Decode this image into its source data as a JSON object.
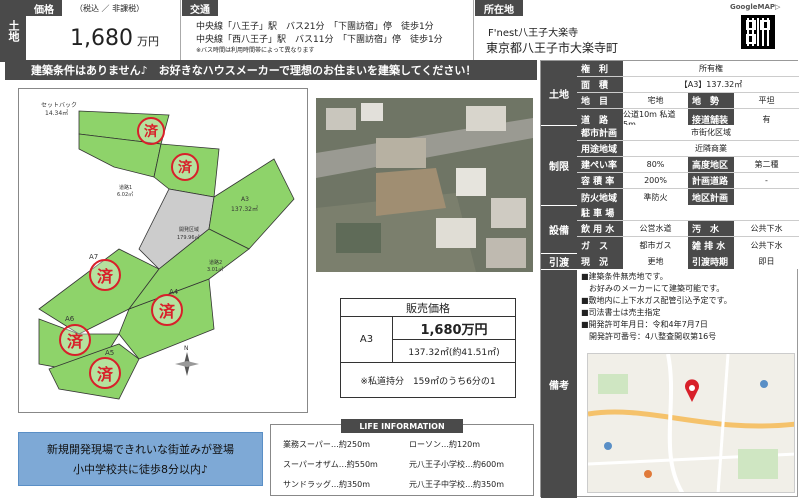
{
  "header": {
    "badge": "土地",
    "price_label": "価格",
    "tax_note": "（税込 ／ 非課税）",
    "price_value": "1,680",
    "price_unit": "万円",
    "access_label": "交通",
    "access_lines": [
      "中央線「八王子」駅　バス21分　「下團訪宿」停　徒歩1分",
      "中央線「西八王子」駅　バス11分　「下團訪宿」停　徒歩1分"
    ],
    "access_note": "※バス時間は利用時間帯によって異なります",
    "location_label": "所在地",
    "map_link": "GoogleMAP▷",
    "location_name": "F'nest八王子大楽寺",
    "location_address": "東京都八王子市大楽寺町"
  },
  "banner": "建築条件はありません♪　お好きなハウスメーカーで理想のお住まいを建築してください！",
  "plot": {
    "labels": [
      "セットバック\n14.34㎡",
      "A3\n137.32㎡",
      "開発区域\n179.96㎡",
      "道路1\n6.02㎡",
      "道路2\n3.01㎡",
      "A7",
      "A4",
      "A6",
      "A5"
    ],
    "sold_mark": "済"
  },
  "price_box": {
    "title": "販売価格",
    "lot": "A3",
    "price": "1,680万円",
    "area": "137.32㎡(約41.51㎡)",
    "share_note": "※私道持分　159㎡のうち6分の1"
  },
  "life": {
    "title": "LIFE INFORMATION",
    "items": [
      "業務スーパー…約250m",
      "ローソン…約120m",
      "スーパーオザム…約550m",
      "元八王子小学校…約600m",
      "サンドラッグ…約350m",
      "元八王子中学校…約350m"
    ]
  },
  "promo": {
    "line1": "新規開発現場できれいな街並みが登場",
    "line2": "小中学校共に徒歩8分以内♪"
  },
  "spec": {
    "land_section": "土地",
    "land": [
      {
        "label": "権　利",
        "value": "所有権"
      },
      {
        "label": "面　積",
        "value": "【A3】137.32㎡"
      },
      {
        "label": "地　目",
        "value": "宅地",
        "label2": "地　勢",
        "value2": "平坦"
      },
      {
        "label": "道　路",
        "value": "公道10m 私道5m",
        "label2": "接道舗装",
        "value2": "有"
      }
    ],
    "restrict_section": "制限",
    "restrict": [
      {
        "label": "都市計画",
        "value": "市街化区域"
      },
      {
        "label": "用途地域",
        "value": "近隣商業"
      },
      {
        "label": "建ぺい率",
        "value": "80%",
        "label2": "高度地区",
        "value2": "第二種"
      },
      {
        "label": "容 積 率",
        "value": "200%",
        "label2": "計画道路",
        "value2": "-"
      },
      {
        "label": "防火地域",
        "value": "準防火",
        "label2": "地区計画",
        "value2": ""
      }
    ],
    "facility_section": "設備",
    "facility": [
      {
        "label": "駐 車 場",
        "value": ""
      },
      {
        "label": "飲 用 水",
        "value": "公営水道",
        "label2": "汚　水",
        "value2": "公共下水"
      },
      {
        "label": "ガ　ス",
        "value": "都市ガス",
        "label2": "雑 排 水",
        "value2": "公共下水"
      }
    ],
    "handover_section": "引渡",
    "handover": [
      {
        "label": "現　況",
        "value": "更地",
        "label2": "引渡時期",
        "value2": "即日"
      }
    ],
    "remarks_section": "備考",
    "remarks": [
      "■建築条件無売地です。",
      "　お好みのメーカーにて建築可能です。",
      "■敷地内に上下水ガス配管引込予定です。",
      "■司法書士は売主指定",
      "■開発許可年月日：令和4年7月7日",
      "　開発許可番号：4八整査開収第16号"
    ]
  },
  "colors": {
    "accent": "#5a8fc6",
    "sold": "#d8202a",
    "lot": "#8ed36a",
    "dark": "#4a4a4a"
  }
}
